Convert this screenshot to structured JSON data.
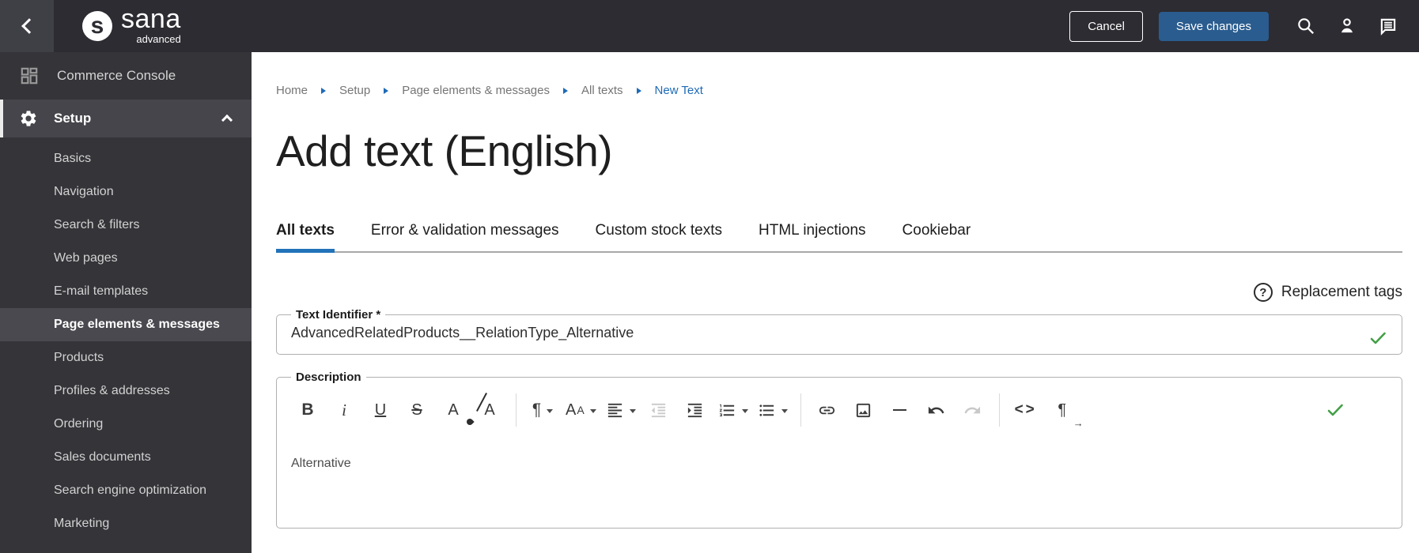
{
  "topbar": {
    "brand": "sana",
    "brand_sub": "advanced",
    "logo_mark": "s",
    "cancel_label": "Cancel",
    "save_label": "Save changes"
  },
  "sidebar": {
    "console_label": "Commerce Console",
    "setup_label": "Setup",
    "items": [
      "Basics",
      "Navigation",
      "Search & filters",
      "Web pages",
      "E-mail templates",
      "Page elements & messages",
      "Products",
      "Profiles & addresses",
      "Ordering",
      "Sales documents",
      "Search engine optimization",
      "Marketing"
    ],
    "active_item": "Page elements & messages"
  },
  "breadcrumb": {
    "items": [
      "Home",
      "Setup",
      "Page elements & messages",
      "All texts"
    ],
    "current": "New Text"
  },
  "page_title": "Add text (English)",
  "tabs": [
    "All texts",
    "Error & validation messages",
    "Custom stock texts",
    "HTML injections",
    "Cookiebar"
  ],
  "active_tab": "All texts",
  "form": {
    "replacement_tags_label": "Replacement tags",
    "help_glyph": "?",
    "text_identifier": {
      "label": "Text Identifier *",
      "value": "AdvancedRelatedProducts__RelationType_Alternative",
      "valid": true
    },
    "description": {
      "label": "Description",
      "content": "Alternative",
      "valid": true
    }
  },
  "editor_glyphs": {
    "bold": "B",
    "italic": "i",
    "underline": "U",
    "strikethrough": "S",
    "text_color": "A",
    "clear_formatting": "A",
    "paragraph": "¶",
    "font_large": "A",
    "font_small": "A",
    "code": "<>",
    "direction": "¶",
    "direction_arrow": "→"
  },
  "colors": {
    "accent_blue": "#2273b9",
    "link_blue": "#1e6bb8",
    "save_button": "#2a5c8f",
    "success_green": "#43a047",
    "topbar_bg": "#2c2c32",
    "sidebar_bg": "#343439"
  }
}
